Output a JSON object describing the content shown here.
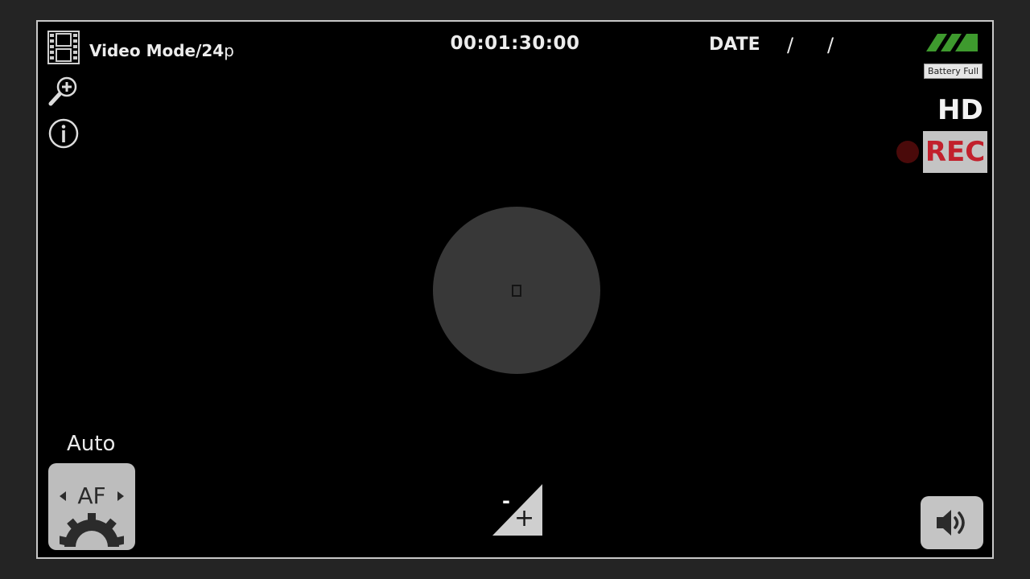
{
  "header": {
    "mode_label": "Video Mode/24",
    "mode_unit": "p",
    "timecode": "00:01:30:00",
    "date_label": "DATE",
    "date_separator": "/"
  },
  "status": {
    "battery_label": "Battery Full",
    "battery_level": 1.0,
    "quality_label": "HD",
    "rec_label": "REC"
  },
  "focus": {
    "mode_label": "Auto",
    "button_label": "AF"
  },
  "exposure": {
    "minus_label": "-",
    "plus_label": "+"
  },
  "icons": {
    "film": "film-strip-icon",
    "zoom": "zoom-in-icon",
    "info": "info-icon",
    "battery": "battery-icon",
    "gear": "gear-icon",
    "volume": "speaker-icon"
  },
  "colors": {
    "background": "#000000",
    "frame_border": "#c8c8c8",
    "rec_text": "#c2202c",
    "battery_green": "#3e9a2e",
    "button_gray": "#c4c4c4",
    "shutter_gray": "#383838"
  }
}
